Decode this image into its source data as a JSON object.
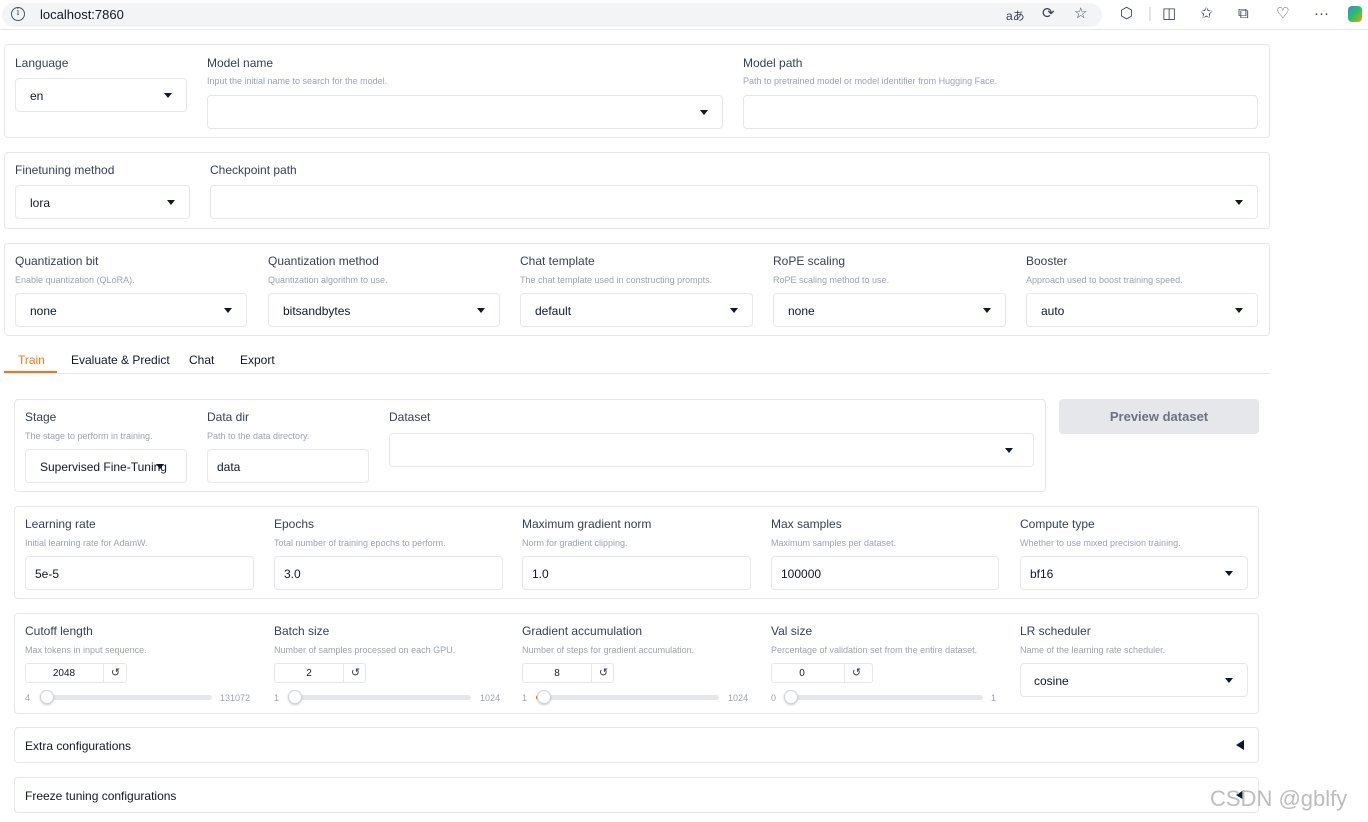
{
  "browser": {
    "url": "localhost:7860",
    "icons": [
      "info-icon",
      "read-aloud-icon",
      "refresh-icon",
      "favorite-star-icon",
      "extensions-icon",
      "split-screen-icon",
      "favorites-icon",
      "collections-icon",
      "health-icon",
      "more-icon",
      "copilot-icon"
    ]
  },
  "top": {
    "language": {
      "label": "Language",
      "value": "en"
    },
    "model_name": {
      "label": "Model name",
      "info": "Input the initial name to search for the model.",
      "value": ""
    },
    "model_path": {
      "label": "Model path",
      "info": "Path to pretrained model or model identifier from Hugging Face.",
      "value": ""
    }
  },
  "finetune": {
    "method": {
      "label": "Finetuning method",
      "value": "lora"
    },
    "checkpoint": {
      "label": "Checkpoint path",
      "value": ""
    }
  },
  "advanced": {
    "quant_bit": {
      "label": "Quantization bit",
      "info": "Enable quantization (QLoRA).",
      "value": "none"
    },
    "quant_method": {
      "label": "Quantization method",
      "info": "Quantization algorithm to use.",
      "value": "bitsandbytes"
    },
    "template": {
      "label": "Chat template",
      "info": "The chat template used in constructing prompts.",
      "value": "default"
    },
    "rope": {
      "label": "RoPE scaling",
      "info": "RoPE scaling method to use.",
      "value": "none"
    },
    "booster": {
      "label": "Booster",
      "info": "Approach used to boost training speed.",
      "value": "auto"
    }
  },
  "tabs": [
    "Train",
    "Evaluate & Predict",
    "Chat",
    "Export"
  ],
  "train": {
    "stage": {
      "label": "Stage",
      "info": "The stage to perform in training.",
      "value": "Supervised Fine-Tuning"
    },
    "data_dir": {
      "label": "Data dir",
      "info": "Path to the data directory.",
      "value": "data"
    },
    "dataset": {
      "label": "Dataset",
      "value": ""
    },
    "preview_button": "Preview dataset",
    "learning_rate": {
      "label": "Learning rate",
      "info": "Initial learning rate for AdamW.",
      "value": "5e-5"
    },
    "epochs": {
      "label": "Epochs",
      "info": "Total number of training epochs to perform.",
      "value": "3.0"
    },
    "max_grad_norm": {
      "label": "Maximum gradient norm",
      "info": "Norm for gradient clipping.",
      "value": "1.0"
    },
    "max_samples": {
      "label": "Max samples",
      "info": "Maximum samples per dataset.",
      "value": "100000"
    },
    "compute_type": {
      "label": "Compute type",
      "info": "Whether to use mixed precision training.",
      "value": "bf16"
    },
    "cutoff_len": {
      "label": "Cutoff length",
      "info": "Max tokens in input sequence.",
      "value": "2048",
      "min": "4",
      "max": "131072"
    },
    "batch_size": {
      "label": "Batch size",
      "info": "Number of samples processed on each GPU.",
      "value": "2",
      "min": "1",
      "max": "1024"
    },
    "grad_accum": {
      "label": "Gradient accumulation",
      "info": "Number of steps for gradient accumulation.",
      "value": "8",
      "min": "1",
      "max": "1024"
    },
    "val_size": {
      "label": "Val size",
      "info": "Percentage of validation set from the entire dataset.",
      "value": "0",
      "min": "0",
      "max": "1"
    },
    "lr_scheduler": {
      "label": "LR scheduler",
      "info": "Name of the learning rate scheduler.",
      "value": "cosine"
    },
    "reset_glyph": "↺",
    "extra_config": "Extra configurations",
    "freeze_config": "Freeze tuning configurations"
  },
  "watermark": "CSDN @gblfy",
  "colors": {
    "accent": "#f97316",
    "border": "#e5e7eb",
    "muted": "#9ca3af"
  }
}
